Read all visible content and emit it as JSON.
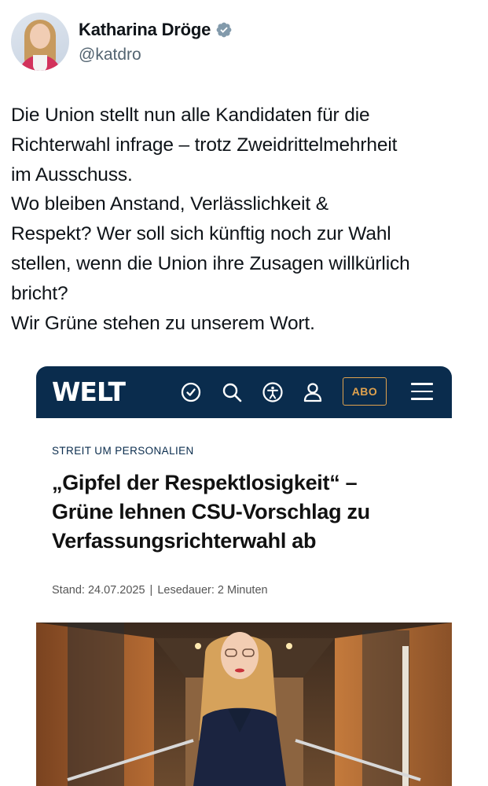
{
  "author": {
    "name": "Katharina Dröge",
    "handle": "@katdro"
  },
  "tweet": {
    "text": "Die Union stellt nun alle Kandidaten für die\nRichterwahl infrage – trotz Zweidrittelmehrheit\nim Ausschuss.\nWo bleiben Anstand, Verlässlichkeit &\nRespekt? Wer soll sich künftig noch zur Wahl\nstellen, wenn die Union ihre Zusagen willkürlich\nbricht?\nWir Grüne stehen zu unserem Wort."
  },
  "article": {
    "logo": "WELT",
    "abo_label": "ABO",
    "kicker": "STREIT UM PERSONALIEN",
    "headline": "„Gipfel der Respektlosigkeit“ –\nGrüne lehnen CSU-Vorschlag zu\nVerfassungsrichterwahl ab",
    "stand": "Stand: 24.07.2025",
    "separator": "|",
    "lesedauer": "Lesedauer: 2 Minuten"
  },
  "colors": {
    "welt_navy": "#0a2c4d",
    "abo_accent": "#e0a24e",
    "verified_badge": "#829aab"
  },
  "icons": [
    "verified-badge-icon",
    "clock-check-icon",
    "search-icon",
    "accessibility-icon",
    "user-icon",
    "hamburger-menu-icon"
  ]
}
